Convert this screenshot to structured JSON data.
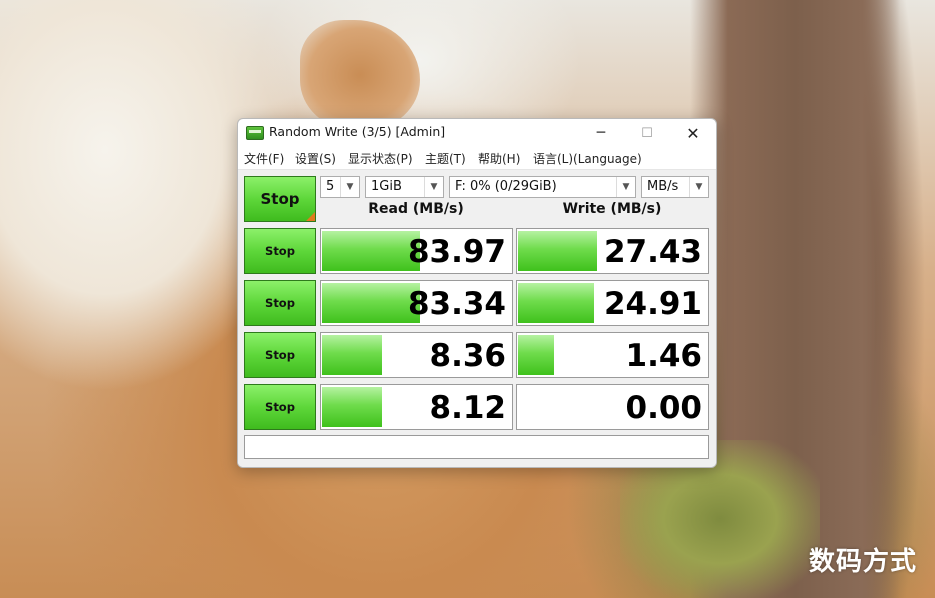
{
  "window": {
    "title": "Random Write (3/5) [Admin]"
  },
  "title_buttons": {
    "minimize": "─",
    "maximize": "☐",
    "close": "✕"
  },
  "menu": [
    "文件(F)",
    "设置(S)",
    "显示状态(P)",
    "主题(T)",
    "帮助(H)",
    "语言(L)(Language)"
  ],
  "controls": {
    "stop_all_label": "Stop",
    "count": "5",
    "size": "1GiB",
    "drive": "F: 0% (0/29GiB)",
    "unit": "MB/s"
  },
  "headers": {
    "read": "Read (MB/s)",
    "write": "Write (MB/s)"
  },
  "rows": [
    {
      "stop_label": "Stop",
      "read": "83.97",
      "write": "27.43",
      "read_level": 0.52,
      "write_level": 0.42
    },
    {
      "stop_label": "Stop",
      "read": "83.34",
      "write": "24.91",
      "read_level": 0.52,
      "write_level": 0.4
    },
    {
      "stop_label": "Stop",
      "read": "8.36",
      "write": "1.46",
      "read_level": 0.32,
      "write_level": 0.19
    },
    {
      "stop_label": "Stop",
      "read": "8.12",
      "write": "0.00",
      "read_level": 0.32,
      "write_level": 0.0
    }
  ],
  "status": "",
  "watermark": "数码方式",
  "colors": {
    "bar_green": "#5ed73a",
    "stop_green": "#4fcf2a",
    "corner_orange": "#e07a1e"
  }
}
